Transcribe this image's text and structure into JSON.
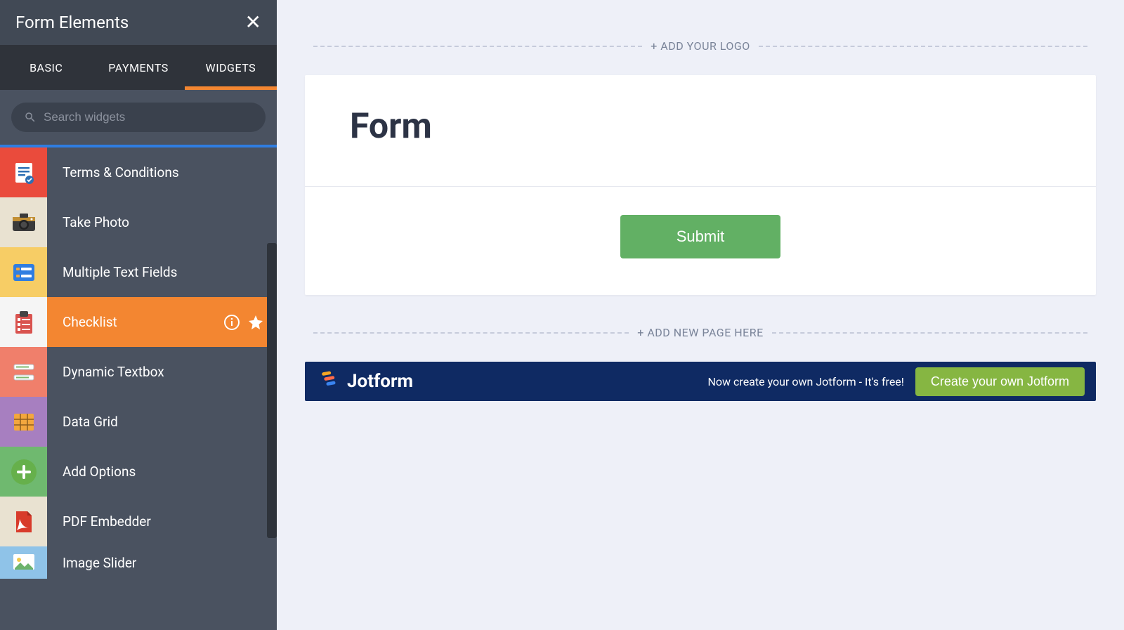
{
  "sidebar": {
    "title": "Form Elements",
    "tabs": [
      "BASIC",
      "PAYMENTS",
      "WIDGETS"
    ],
    "active_tab": 2,
    "search_placeholder": "Search widgets",
    "widgets": [
      {
        "label": "Terms & Conditions",
        "icon": "document-check-icon",
        "bg": "bg-red"
      },
      {
        "label": "Take Photo",
        "icon": "camera-icon",
        "bg": "bg-cream"
      },
      {
        "label": "Multiple Text Fields",
        "icon": "text-fields-icon",
        "bg": "bg-yellow"
      },
      {
        "label": "Checklist",
        "icon": "checklist-icon",
        "bg": "bg-white",
        "active": true
      },
      {
        "label": "Dynamic Textbox",
        "icon": "dynamic-textbox-icon",
        "bg": "bg-salmon"
      },
      {
        "label": "Data Grid",
        "icon": "grid-icon",
        "bg": "bg-purple"
      },
      {
        "label": "Add Options",
        "icon": "plus-icon",
        "bg": "bg-green"
      },
      {
        "label": "PDF Embedder",
        "icon": "pdf-icon",
        "bg": "bg-ltgrey"
      },
      {
        "label": "Image Slider",
        "icon": "image-slider-icon",
        "bg": "bg-sky"
      }
    ]
  },
  "canvas": {
    "add_logo_label": "+ ADD YOUR LOGO",
    "form_title": "Form",
    "submit_label": "Submit",
    "add_page_label": "+ ADD NEW PAGE HERE"
  },
  "promo": {
    "brand": "Jotform",
    "text": "Now create your own Jotform - It's free!",
    "cta": "Create your own Jotform"
  }
}
